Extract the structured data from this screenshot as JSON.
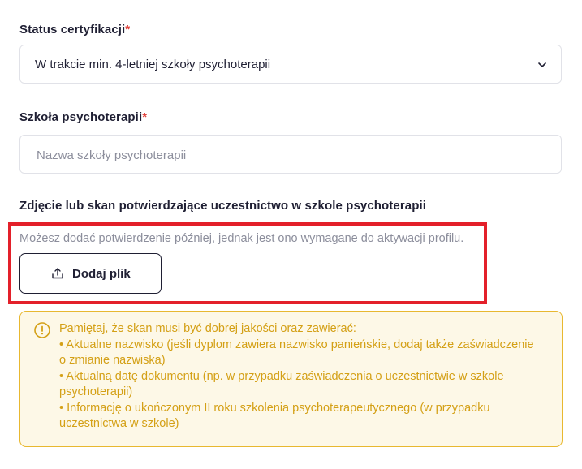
{
  "status": {
    "label": "Status certyfikacji",
    "required_mark": "*",
    "selected_value": "W trakcie min. 4-letniej szkoły psychoterapii",
    "icon": "chevron-down-icon"
  },
  "school": {
    "label": "Szkoła psychoterapii",
    "required_mark": "*",
    "placeholder": "Nazwa szkoły psychoterapii",
    "value": ""
  },
  "upload": {
    "label": "Zdjęcie lub skan potwierdzające uczestnictwo w szkole psychoterapii",
    "helper": "Możesz dodać potwierdzenie później, jednak jest ono wymagane do aktywacji profilu.",
    "button_label": "Dodaj plik",
    "icon": "upload-icon"
  },
  "notice": {
    "icon": "alert-circle-icon",
    "intro": "Pamiętaj, że skan musi być dobrej jakości oraz zawierać:",
    "items": [
      "• Aktualne nazwisko (jeśli dyplom zawiera nazwisko panieńskie, dodaj także zaświadczenie o zmianie nazwiska)",
      "• Aktualną datę dokumentu (np. w przypadku zaświadczenia o uczestnictwie w szkole psychoterapii)",
      "• Informację o ukończonym II roku szkolenia psychoterapeutycznego (w przypadku uczestnictwa w szkole)"
    ]
  },
  "colors": {
    "accent_required": "#e0443e",
    "highlight_border": "#e3202a",
    "notice_text": "#d4a016",
    "notice_border": "#e8b830",
    "notice_bg": "#fdf8e7"
  }
}
